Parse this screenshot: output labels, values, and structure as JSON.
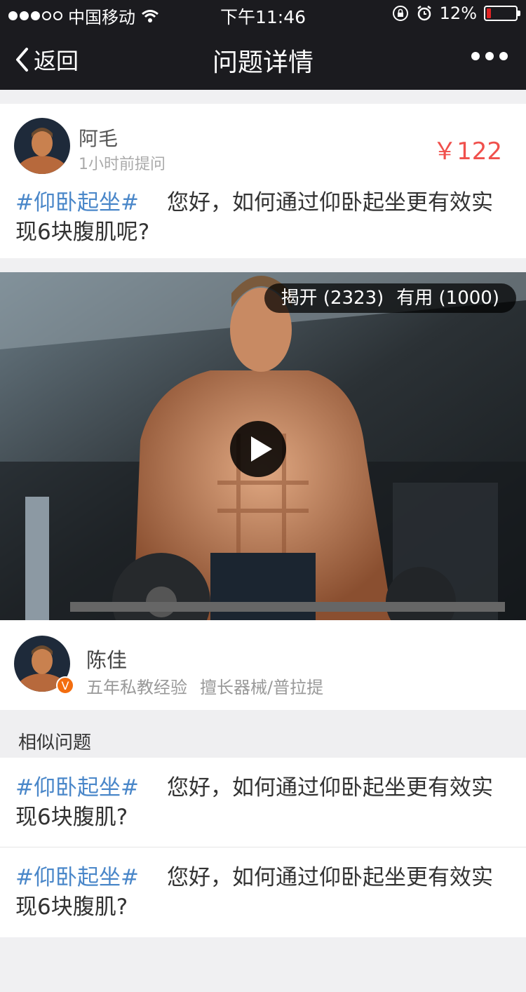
{
  "status_bar": {
    "carrier": "中国移动",
    "time": "下午11:46",
    "battery": "12%",
    "battery_level": 0.12,
    "icons": [
      "signal-dots-icon",
      "wifi-icon",
      "rotation-lock-icon",
      "alarm-icon",
      "battery-icon"
    ]
  },
  "nav": {
    "back_label": "返回",
    "title": "问题详情",
    "more_icon": "ellipsis-icon"
  },
  "question": {
    "asker_name": "阿毛",
    "asked_time": "1小时前提问",
    "price": "￥122",
    "tag": "#仰卧起坐#",
    "text": "您好，如何通过仰卧起坐更有效实现6块腹肌呢?"
  },
  "video": {
    "reveal_label": "揭开 (2323)",
    "useful_label": "有用 (1000)",
    "play_icon": "play-icon"
  },
  "answerer": {
    "name": "陈佳",
    "experience": "五年私教经验",
    "specialty": "擅长器械/普拉提",
    "badge": "V"
  },
  "similar": {
    "header": "相似问题",
    "items": [
      {
        "tag": "#仰卧起坐#",
        "text": "您好，如何通过仰卧起坐更有效实现6块腹肌?"
      },
      {
        "tag": "#仰卧起坐#",
        "text": "您好，如何通过仰卧起坐更有效实现6块腹肌?"
      }
    ]
  },
  "colors": {
    "nav_bg": "#1b1b1f",
    "tag_blue": "#4a87c9",
    "price_red": "#f0504c",
    "badge_orange": "#f36d0f"
  }
}
